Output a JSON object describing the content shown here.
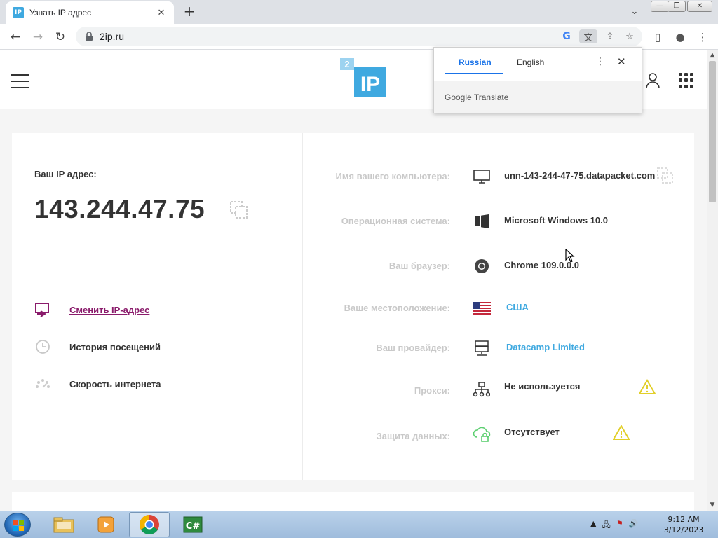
{
  "browser": {
    "tab": {
      "title": "Узнать IP адрес",
      "favicon": "IP",
      "close": "✕"
    },
    "newtab": "+",
    "tab_menu": "⌄",
    "window_controls": {
      "minimize": "—",
      "maximize": "❐",
      "close": "✕"
    },
    "nav": {
      "back": "←",
      "forward": "→",
      "reload": "↻"
    },
    "url": "2ip.ru",
    "omnibox_icons": {
      "google": "G",
      "translate": "文",
      "share": "⇪",
      "bookmark": "☆"
    },
    "right_icons": {
      "side_panel": "▯",
      "profile": "●",
      "menu": "⋮"
    }
  },
  "site": {
    "logo_badge": "2",
    "logo_text": "IP",
    "ip_label": "Ваш IP адрес:",
    "ip_value": "143.244.47.75",
    "actions": {
      "change_ip": "Сменить IP-адрес",
      "history": "История посещений",
      "speed": "Скорость интернета"
    },
    "info": {
      "computer_name": {
        "label": "Имя вашего компьютера:",
        "value": "unn-143-244-47-75.datapacket.com"
      },
      "os": {
        "label": "Операционная система:",
        "value": "Microsoft Windows 10.0"
      },
      "browser": {
        "label": "Ваш браузер:",
        "value": "Chrome 109.0.0.0"
      },
      "location": {
        "label": "Ваше местоположение:",
        "value": "США"
      },
      "provider": {
        "label": "Ваш провайдер:",
        "value": "Datacamp Limited"
      },
      "proxy": {
        "label": "Прокси:",
        "value": "Не используется"
      },
      "protection": {
        "label": "Защита данных:",
        "value": "Отсутствует"
      }
    },
    "colors": {
      "accent": "#3fa9e0",
      "change_ip": "#8a1b6b",
      "warning": "#e2cf2a",
      "label": "#c9c9c9"
    }
  },
  "translate_popup": {
    "tabs": [
      "Russian",
      "English"
    ],
    "active_tab": "Russian",
    "more": "⋮",
    "close": "✕",
    "brand": "Google Translate"
  },
  "scrollbar": {
    "up": "▲",
    "down": "▼"
  },
  "taskbar": {
    "tray": {
      "arrow": "▲",
      "network": "🖧",
      "flag": "⚑",
      "volume": "🔊"
    },
    "time": "9:12 AM",
    "date": "3/12/2023"
  }
}
